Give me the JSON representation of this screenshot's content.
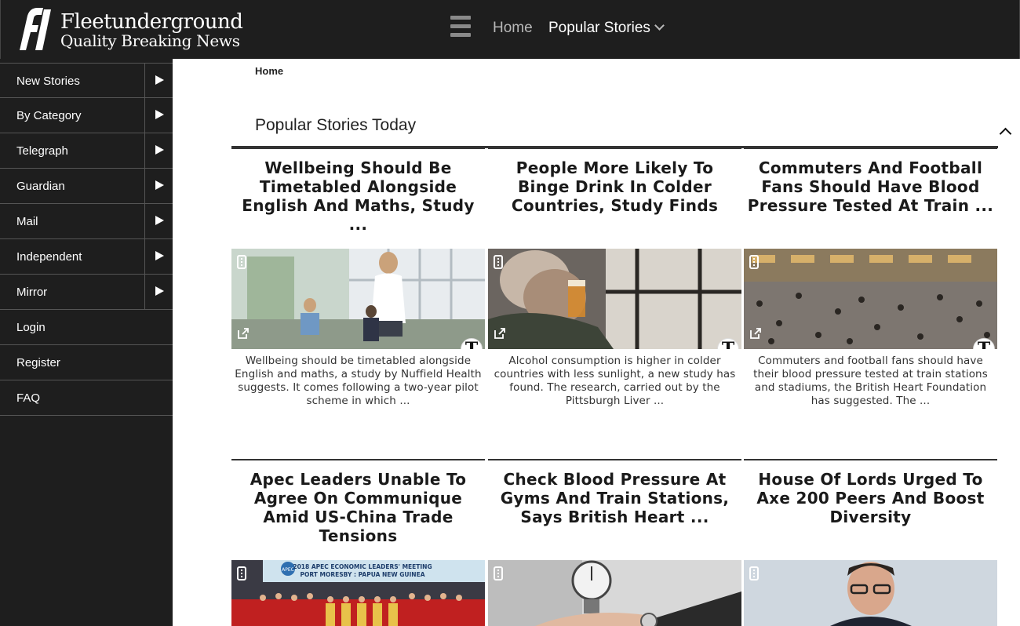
{
  "brand": {
    "name": "Fleetunderground",
    "tagline": "Quality Breaking News",
    "logo_text": "fl"
  },
  "top_nav": {
    "menu_icon": "hamburger-icon",
    "home_label": "Home",
    "popular_label": "Popular Stories"
  },
  "sidebar": {
    "items": [
      {
        "label": "New Stories",
        "has_arrow": true
      },
      {
        "label": "By Category",
        "has_arrow": true
      },
      {
        "label": "Telegraph",
        "has_arrow": true
      },
      {
        "label": "Guardian",
        "has_arrow": true
      },
      {
        "label": "Mail",
        "has_arrow": true
      },
      {
        "label": "Independent",
        "has_arrow": true
      },
      {
        "label": "Mirror",
        "has_arrow": true
      },
      {
        "label": "Login",
        "has_arrow": false
      },
      {
        "label": "Register",
        "has_arrow": false
      },
      {
        "label": "FAQ",
        "has_arrow": false
      }
    ]
  },
  "main": {
    "breadcrumb": "Home",
    "section_title": "Popular Stories Today",
    "cards": [
      {
        "title": "Wellbeing Should Be Timetabled Alongside English And Maths, Study ...",
        "description": "Wellbeing should be timetabled alongside English and maths, a study by Nuffield Health suggests. It comes following a two-year pilot scheme in which ...",
        "source_badge": "T"
      },
      {
        "title": "People More Likely To Binge Drink In Colder Countries, Study Finds",
        "description": "Alcohol consumption is higher in colder countries with less sunlight, a new study has found. The research, carried out by the Pittsburgh Liver ...",
        "source_badge": "T"
      },
      {
        "title": "Commuters And Football Fans Should Have Blood Pressure Tested At Train ...",
        "description": "Commuters and football fans should have their blood pressure tested at train stations and stadiums, the British Heart Foundation has suggested. The ...",
        "source_badge": "T"
      },
      {
        "title": "Apec Leaders Unable To Agree On Communique Amid US-China Trade Tensions",
        "image_text": {
          "line1": "2018 APEC ECONOMIC LEADERS' MEETING",
          "line2": "PORT MORESBY : PAPUA NEW GUINEA",
          "logo": "APEC"
        }
      },
      {
        "title": "Check Blood Pressure At Gyms And Train Stations, Says British Heart ..."
      },
      {
        "title": "House Of Lords Urged To Axe 200 Peers And Boost Diversity"
      }
    ]
  }
}
